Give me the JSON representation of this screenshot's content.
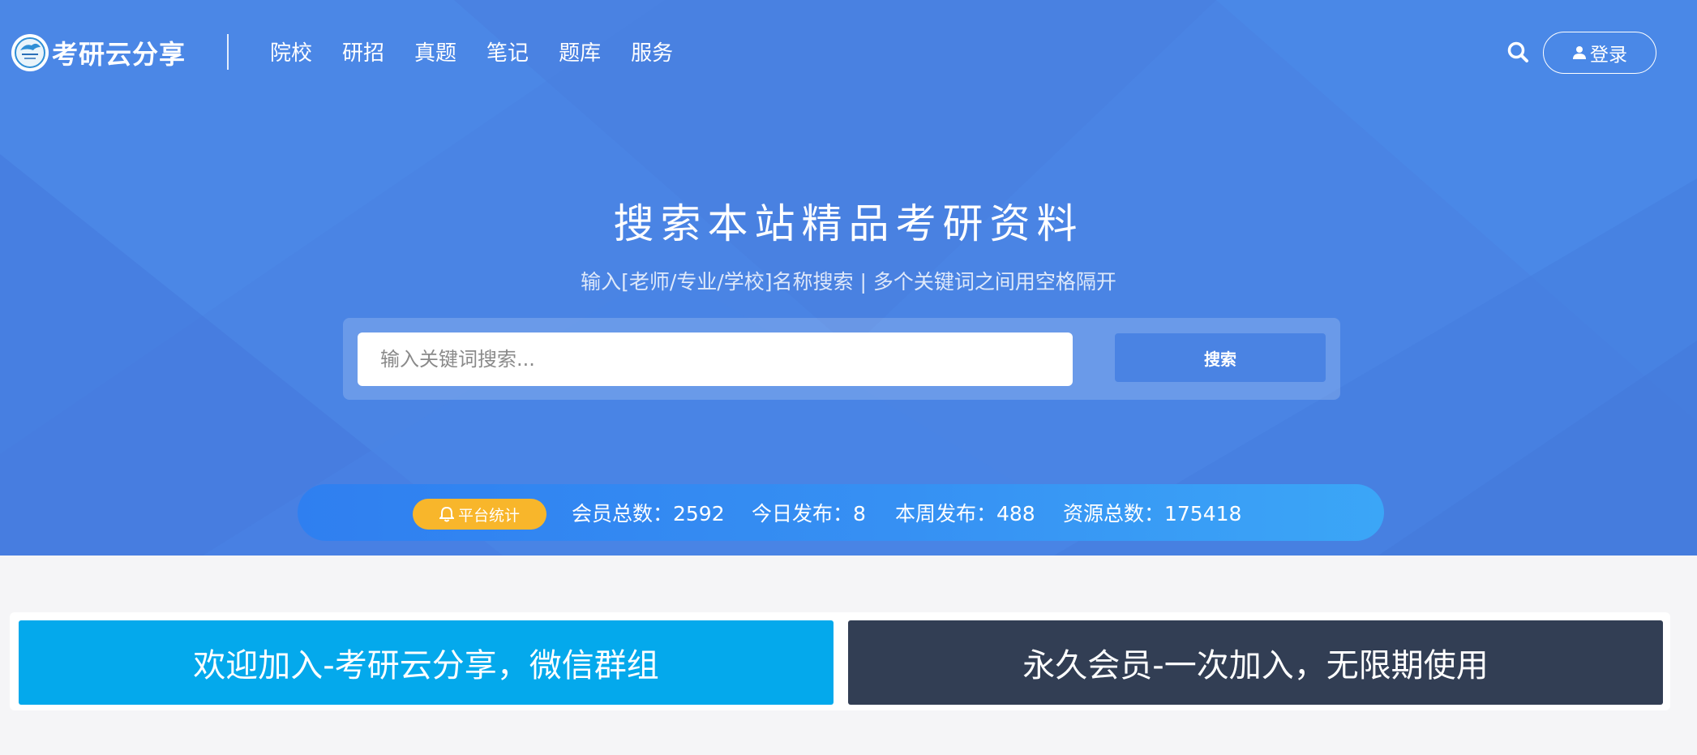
{
  "colors": {
    "hero_bg": "#4a83e3",
    "accent": "#4a83e3",
    "badge": "#f8b62b",
    "promo_left": "#04a9ec",
    "promo_right": "#323e54",
    "page_bg": "#f5f5f7"
  },
  "header": {
    "logo_icon": "kaoyan-logo-icon",
    "logo_text": "考研云分享",
    "nav": [
      {
        "label": "院校"
      },
      {
        "label": "研招"
      },
      {
        "label": "真题"
      },
      {
        "label": "笔记"
      },
      {
        "label": "题库"
      },
      {
        "label": "服务"
      }
    ],
    "search_icon": "search-icon",
    "login_icon": "user-icon",
    "login_label": "登录"
  },
  "hero": {
    "title": "搜索本站精品考研资料",
    "subtitle": "输入[老师/专业/学校]名称搜索 | 多个关键词之间用空格隔开",
    "search_placeholder": "输入关键词搜索...",
    "search_button": "搜索"
  },
  "stats": {
    "badge_icon": "bell-icon",
    "badge_label": "平台统计",
    "members": "会员总数：2592",
    "today": "今日发布：8",
    "week": "本周发布：488",
    "total": "资源总数：175418"
  },
  "promos": {
    "left": "欢迎加入-考研云分享，微信群组",
    "right": "永久会员-一次加入，无限期使用"
  }
}
